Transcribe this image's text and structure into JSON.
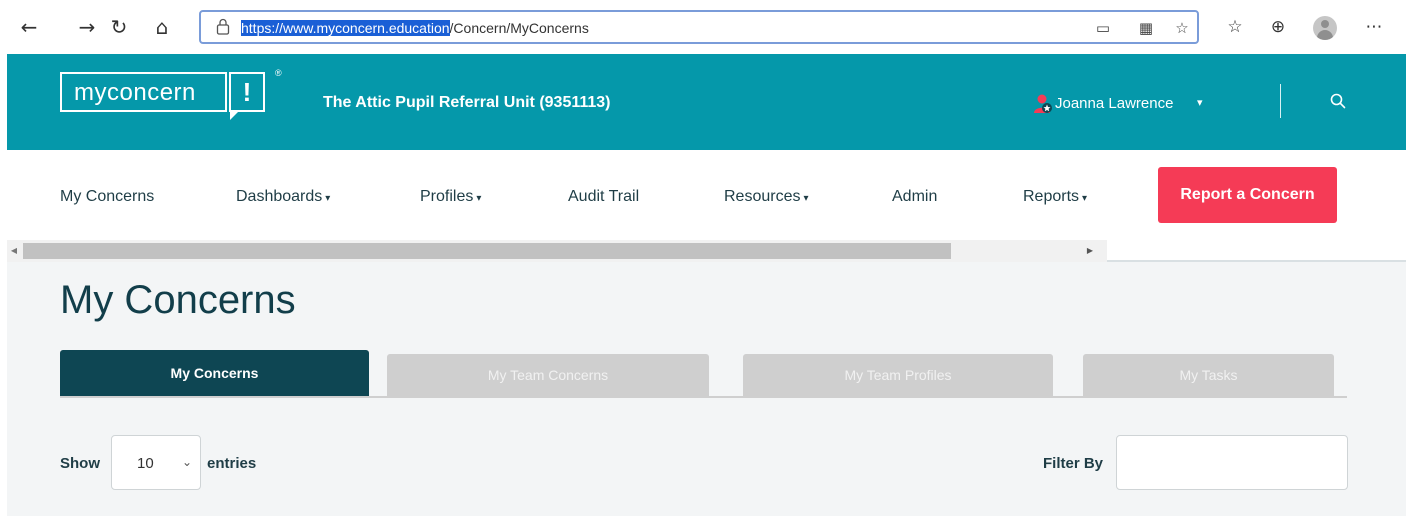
{
  "browser": {
    "url_host": "https://www.myconcern.education",
    "url_path": "/Concern/MyConcerns",
    "back_icon": "back-arrow-icon",
    "forward_icon": "forward-arrow-icon",
    "refresh_icon": "refresh-icon",
    "home_icon": "home-icon"
  },
  "header": {
    "logo_text": "myconcern",
    "logo_mark": "!",
    "logo_reg": "®",
    "school_name": "The Attic Pupil Referral Unit (9351113)",
    "user_name": "Joanna Lawrence",
    "user_caret": "▾",
    "brand_color": "#0598aa"
  },
  "nav": {
    "items": [
      {
        "label": "My Concerns",
        "caret": ""
      },
      {
        "label": "Dashboards",
        "caret": "▾"
      },
      {
        "label": "Profiles",
        "caret": "▾"
      },
      {
        "label": "Audit Trail",
        "caret": ""
      },
      {
        "label": "Resources",
        "caret": "▾"
      },
      {
        "label": "Admin",
        "caret": ""
      },
      {
        "label": "Reports",
        "caret": "▾"
      }
    ],
    "report_button": "Report a Concern",
    "report_color": "#f53b56"
  },
  "main": {
    "title": "My Concerns",
    "tabs": [
      {
        "label": "My Concerns",
        "active": true
      },
      {
        "label": "My Team Concerns",
        "active": false
      },
      {
        "label": "My Team Profiles",
        "active": false
      },
      {
        "label": "My Tasks",
        "active": false
      }
    ],
    "show_label": "Show",
    "entries_value": "10",
    "entries_label": "entries",
    "filter_label": "Filter By",
    "filter_value": ""
  }
}
